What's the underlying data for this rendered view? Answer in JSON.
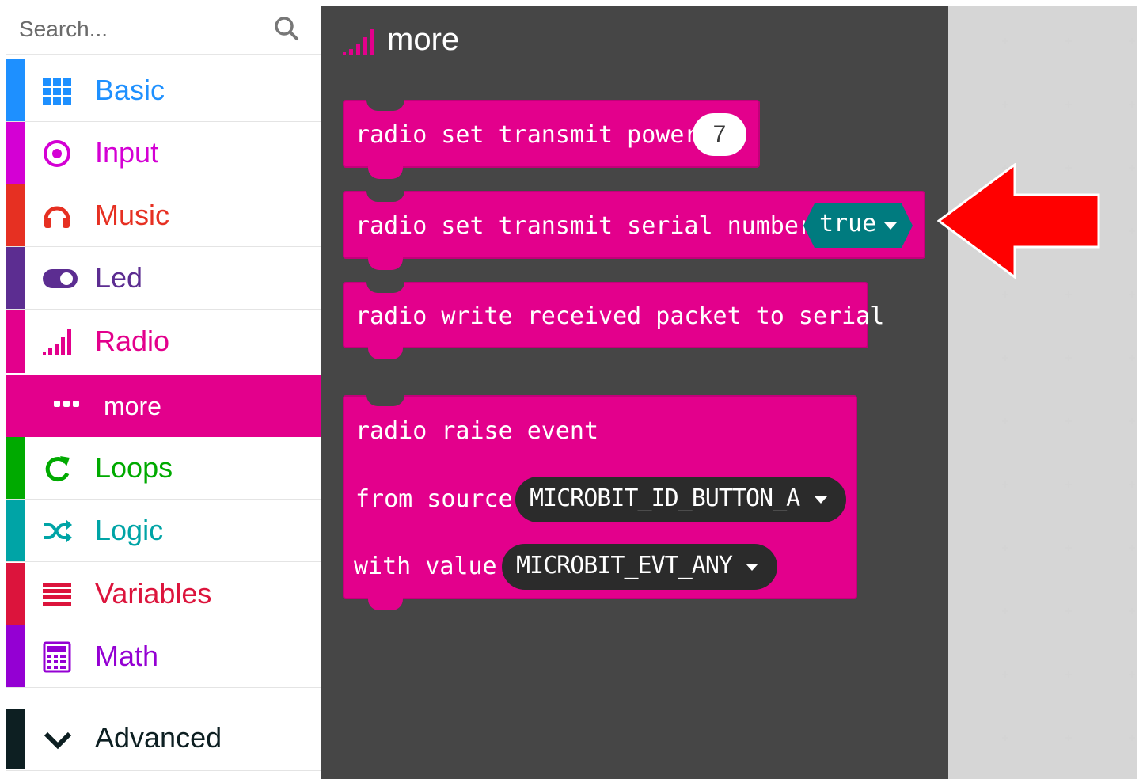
{
  "search": {
    "placeholder": "Search..."
  },
  "toolbox": {
    "categories": [
      {
        "label": "Basic",
        "color": "#1e90ff",
        "icon": "grid-icon"
      },
      {
        "label": "Input",
        "color": "#d400d4",
        "icon": "radio-target-icon"
      },
      {
        "label": "Music",
        "color": "#e63022",
        "icon": "headphones-icon"
      },
      {
        "label": "Led",
        "color": "#5c2d91",
        "icon": "toggle-icon"
      },
      {
        "label": "Radio",
        "color": "#e3008c",
        "icon": "signal-bars-icon"
      },
      {
        "label": "Loops",
        "color": "#00aa00",
        "icon": "loop-arrow-icon"
      },
      {
        "label": "Logic",
        "color": "#00a4a6",
        "icon": "shuffle-icon"
      },
      {
        "label": "Variables",
        "color": "#dc143c",
        "icon": "lines-icon"
      },
      {
        "label": "Math",
        "color": "#9400d3",
        "icon": "calculator-icon"
      }
    ],
    "more": {
      "label": "more",
      "icon": "ellipsis-icon"
    },
    "advanced": {
      "label": "Advanced",
      "icon": "chevron-down-icon"
    }
  },
  "flyout": {
    "title": "more",
    "blocks": {
      "transmit_power": {
        "text": "radio set transmit power",
        "value": "7"
      },
      "serial_number": {
        "text": "radio set transmit serial number",
        "value": "true"
      },
      "write_packet": {
        "text": "radio write received packet to serial"
      },
      "raise_event": {
        "text": "radio raise event",
        "source_label": "from source",
        "source_value": "MICROBIT_ID_BUTTON_A",
        "value_label": "with value",
        "value_value": "MICROBIT_EVT_ANY"
      }
    }
  },
  "colors": {
    "radio": "#e3008c",
    "flyout_bg": "#464646",
    "boolean": "#007b7f",
    "arrow": "#ff0000"
  }
}
